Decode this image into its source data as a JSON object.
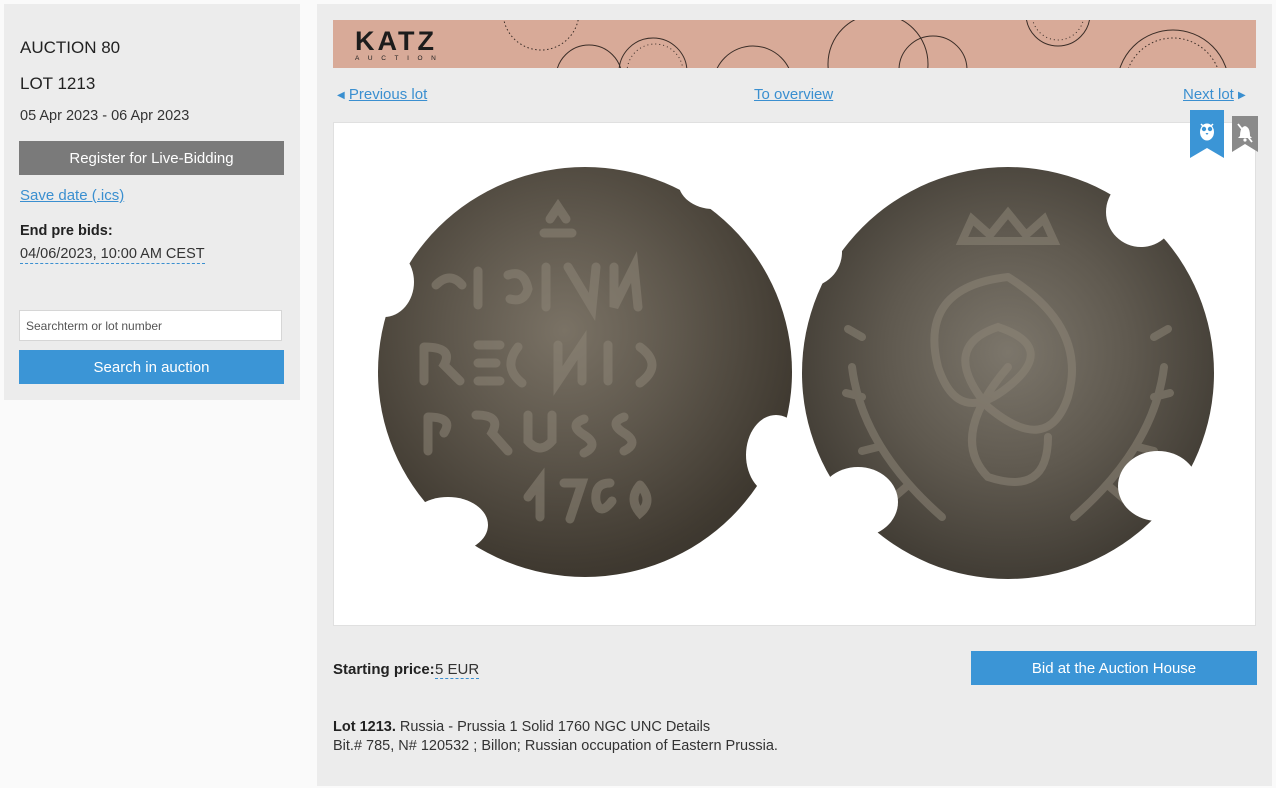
{
  "sidebar": {
    "auction": "AUCTION 80",
    "lot": "LOT 1213",
    "dates": "05 Apr 2023 - 06 Apr 2023",
    "live_bidding_label": "Register for Live-Bidding",
    "save_date_label": "Save date (.ics)",
    "end_pre_bids_label": "End pre bids:",
    "end_pre_bids_value": "04/06/2023, 10:00 AM CEST",
    "search_placeholder": "Searchterm or lot number",
    "search_button_label": "Search in auction"
  },
  "banner": {
    "brand": "KATZ",
    "brand_sub": "AUCTION",
    "background_color": "#d8aa98"
  },
  "nav": {
    "previous_label": "Previous lot",
    "overview_label": "To overview",
    "next_label": "Next lot"
  },
  "image": {
    "icons": [
      "owl-bookmark-icon",
      "bell-off-icon"
    ]
  },
  "price": {
    "label": "Starting price:",
    "value": "5 EUR"
  },
  "bid_button_label": "Bid at the Auction House",
  "description": {
    "lot_label": "Lot 1213.",
    "title": "Russia - Prussia 1 Solid 1760 NGC UNC Details",
    "details": "Bit.# 785, N# 120532 ; Billon; Russian occupation of Eastern Prussia."
  },
  "colors": {
    "accent": "#3b95d6",
    "link": "#3a8fd0",
    "live_button": "#7a7a7a"
  }
}
